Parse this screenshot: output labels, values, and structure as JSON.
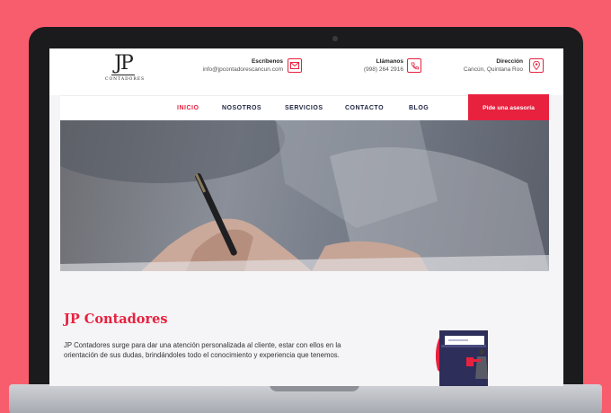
{
  "header": {
    "logo": {
      "mark": "JP",
      "text": "CONTADORES"
    },
    "email": {
      "title": "Escríbenos",
      "value": "info@jpcontadorescancun.com",
      "icon": "mail-icon"
    },
    "phone": {
      "title": "Llámanos",
      "value": "(998) 264 2916",
      "icon": "phone-icon"
    },
    "address": {
      "title": "Dirección",
      "value": "Cancún, Quintana Roo",
      "icon": "map-pin-icon"
    }
  },
  "nav": {
    "items": [
      "INICIO",
      "NOSOTROS",
      "SERVICIOS",
      "CONTACTO",
      "BLOG"
    ],
    "active": "INICIO",
    "cta": "Pide una asesoría"
  },
  "main": {
    "title": "JP Contadores",
    "body": "JP Contadores surge para dar una atención personalizada al cliente, estar con ellos en la orientación de sus dudas, brindándoles todo el conocimiento y experiencia que tenemos."
  },
  "colors": {
    "accent": "#e8213f",
    "nav_text": "#1e2340",
    "backdrop": "#f85d6e"
  }
}
